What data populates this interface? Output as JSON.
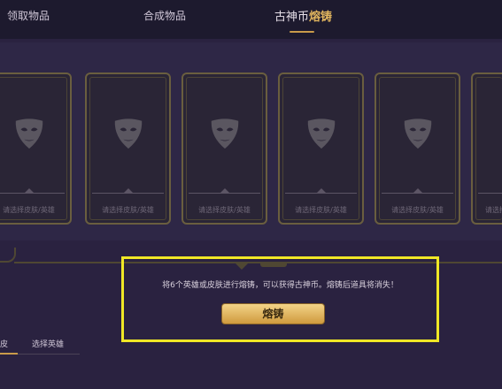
{
  "tabs": {
    "claim": "领取物品",
    "compose": "合成物品",
    "forge_prefix": "古神币",
    "forge_highlight": "熔铸"
  },
  "slots": [
    {
      "label": "请选择皮肤/英雄"
    },
    {
      "label": "请选择皮肤/英雄"
    },
    {
      "label": "请选择皮肤/英雄"
    },
    {
      "label": "请选择皮肤/英雄"
    },
    {
      "label": "请选择皮肤/英雄"
    },
    {
      "label": "请选择皮肤/英雄"
    }
  ],
  "info_text": "将6个英雄或皮肤进行熔铸，可以获得古神币。熔铸后道具将消失！",
  "forge_button": "熔铸",
  "bottom_tabs": {
    "first": "皮",
    "second": "选择英雄"
  },
  "colors": {
    "accent": "#c99b4a",
    "highlight_box": "#f0e726",
    "background": "#2a2240"
  }
}
